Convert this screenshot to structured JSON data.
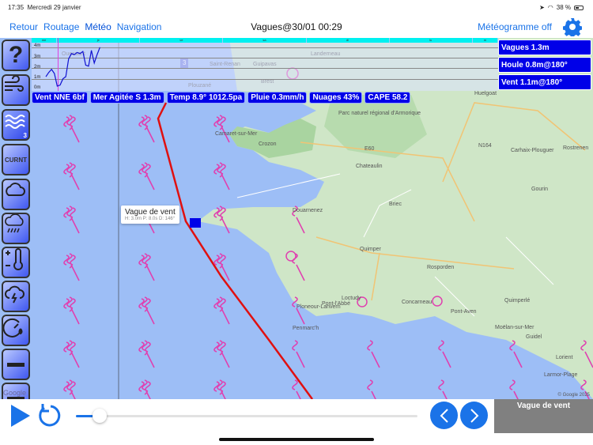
{
  "status": {
    "time": "17:35",
    "date": "Mercredi 29 janvier",
    "battery": "38 %"
  },
  "nav": {
    "links": [
      "Retour",
      "Routage",
      "Météo",
      "Navigation"
    ],
    "active": "Météo",
    "title": "Vagues@30/01 00:29",
    "meteogram_toggle": "Météogramme off"
  },
  "toolbar": {
    "help": "?",
    "current": "CURNT",
    "wave_badge": "3"
  },
  "meteogram": {
    "days": [
      "me",
      "je",
      "ve",
      "sa",
      "di",
      "lu",
      "m"
    ],
    "y_labels": [
      "4m",
      "3m",
      "2m",
      "1m",
      "0m"
    ],
    "wave_height_m": [
      1.2,
      1.6,
      1.9,
      1.5,
      0.3,
      0.4,
      1.0,
      1.2,
      2.9,
      3.4,
      3.3,
      3.5,
      3.4,
      3.6,
      2.3,
      2.2,
      3.7,
      2.5,
      3.3,
      4.0
    ]
  },
  "right_panel": {
    "waves": "Vagues 1.3m",
    "swell": "Houle 0.8m@180°",
    "wind_wave": "Vent 1.1m@180°"
  },
  "chips": [
    "Vent NNE 6bf",
    "Mer Agitée S 1.3m",
    "Temp 8.9° 1012.5pa",
    "Pluie 0.3mm/h",
    "Nuages 43%",
    "CAPE 58.2"
  ],
  "popup": {
    "title": "Vague de vent",
    "detail": "H: 3.0m P: 8.0s D: 146°"
  },
  "map": {
    "places": [
      "Ouessant",
      "Saint-Renan",
      "Guipavas",
      "Landerneau",
      "Plouzané",
      "Brest",
      "Huelgoat",
      "Camaret-sur-Mer",
      "Crozon",
      "Parc naturel régional d'Armorique",
      "Chateaulin",
      "Carhaix-Plouguer",
      "Rostrenen",
      "Gourin",
      "Douarnenez",
      "Briec",
      "Quimper",
      "Rosporden",
      "Ploneour-Lanvern",
      "Pont-l'Abbé",
      "Loctudy",
      "Concarneau",
      "Pont-Aven",
      "Quimperlé",
      "Penmarc'h",
      "Moëlan-sur-Mer",
      "Guidel",
      "Lorient",
      "Larmor-Plage",
      "E60",
      "N164"
    ],
    "marker": "3",
    "copyright": "© Google 2025",
    "google": "Google"
  },
  "bottom": {
    "panel_label": "Vague de vent",
    "timeline_progress": 0.07
  },
  "colors": {
    "accent": "#1a73e8",
    "chip": "#0000e8",
    "route": "#e01010",
    "wave_symbol": "#e040b0",
    "sea": "#9dbef6"
  }
}
